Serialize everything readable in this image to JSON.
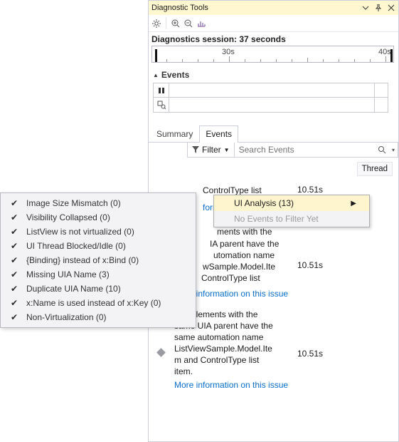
{
  "titlebar": {
    "title": "Diagnostic Tools"
  },
  "session": {
    "title_prefix": "Diagnostics session: ",
    "seconds_label": "37 seconds",
    "ruler_labels": [
      "30s",
      "40s"
    ]
  },
  "events_section": {
    "heading": "Events"
  },
  "tabs": {
    "summary": "Summary",
    "events": "Events"
  },
  "filter": {
    "label": "Filter",
    "search_placeholder": "Search Events"
  },
  "menu": {
    "ui_analysis": "UI Analysis (13)",
    "no_events": "No Events to Filter Yet"
  },
  "submenu": [
    {
      "label": "Image Size Mismatch (0)"
    },
    {
      "label": "Visibility Collapsed (0)"
    },
    {
      "label": "ListView is not virtualized (0)"
    },
    {
      "label": "UI Thread Blocked/Idle (0)"
    },
    {
      "label": "{Binding} instead of x:Bind (0)"
    },
    {
      "label": "Missing UIA Name (3)"
    },
    {
      "label": "Duplicate UIA Name (10)"
    },
    {
      "label": "x:Name is used instead of x:Key (0)"
    },
    {
      "label": "Non-Virtualization (0)"
    }
  ],
  "columns": {
    "thread": "Thread"
  },
  "entries": [
    {
      "frag_text": "ControlType list",
      "link": "formation on this",
      "time": "10.51s"
    },
    {
      "frag_head": "ments with the",
      "frag_lines": [
        "IA parent have the",
        "utomation name",
        "wSample.Model.Ite",
        "ControlType list"
      ],
      "link": "More information on this issue",
      "time": "10.51s"
    },
    {
      "full_lines": [
        "UIA Elements with the",
        "same UIA parent have the",
        "same automation name",
        "ListViewSample.Model.Ite",
        "m and ControlType list",
        "item."
      ],
      "link": "More information on this issue",
      "time": "10.51s"
    }
  ],
  "colors": {
    "accent": "#fef5cf"
  },
  "chart_data": {
    "type": "timeline",
    "unit": "seconds",
    "visible_range": [
      25,
      42
    ],
    "tick_interval": 1,
    "labeled_ticks": [
      30,
      40
    ],
    "markers": [
      26,
      41
    ]
  }
}
